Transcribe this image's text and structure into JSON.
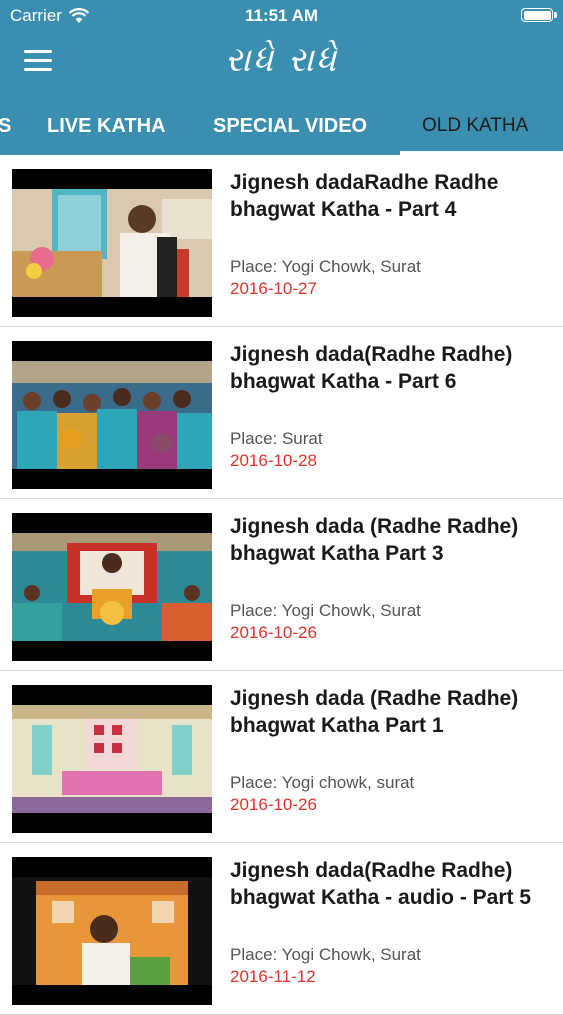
{
  "status": {
    "carrier": "Carrier",
    "time": "11:51 AM"
  },
  "app": {
    "title": "રાધે રાધે"
  },
  "tabs": [
    {
      "label": "S"
    },
    {
      "label": "LIVE KATHA"
    },
    {
      "label": "SPECIAL VIDEO"
    },
    {
      "label": "OLD KATHA",
      "active": true
    }
  ],
  "videos": [
    {
      "title": "Jignesh dadaRadhe Radhe bhagwat Katha - Part 4",
      "place": "Place: Yogi Chowk, Surat",
      "date": "2016-10-27"
    },
    {
      "title": "Jignesh dada(Radhe Radhe) bhagwat Katha - Part 6",
      "place": "Place: Surat",
      "date": "2016-10-28"
    },
    {
      "title": "Jignesh dada (Radhe Radhe) bhagwat Katha Part 3",
      "place": "Place: Yogi Chowk, Surat",
      "date": "2016-10-26"
    },
    {
      "title": "Jignesh dada (Radhe Radhe) bhagwat Katha Part 1",
      "place": "Place: Yogi chowk, surat",
      "date": "2016-10-26"
    },
    {
      "title": "Jignesh dada(Radhe Radhe) bhagwat Katha - audio - Part 5",
      "place": "Place: Yogi Chowk, Surat",
      "date": "2016-11-12"
    }
  ],
  "colors": {
    "header": "#3a8fb0",
    "date": "#e0322b"
  }
}
